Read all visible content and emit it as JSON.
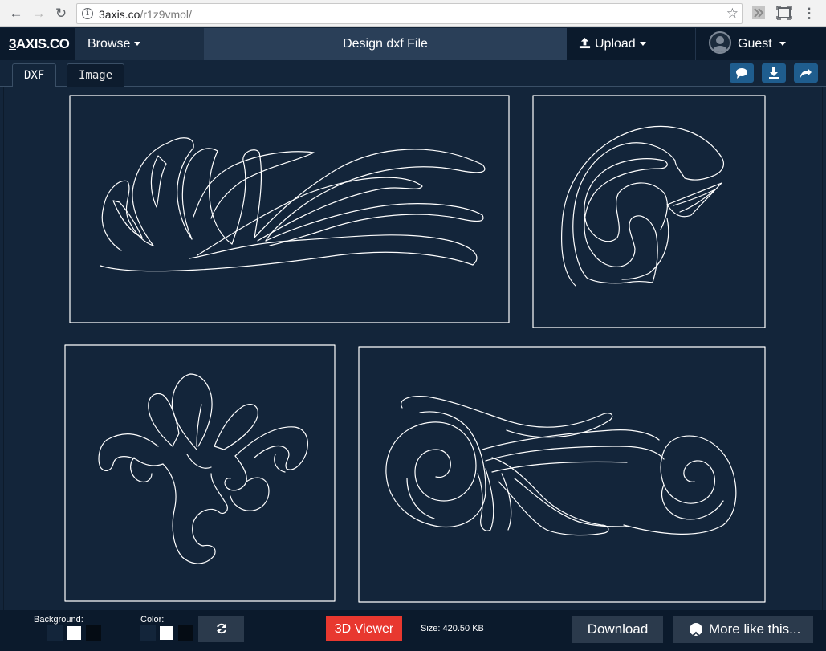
{
  "browser": {
    "url_host": "3axis.co",
    "url_path": "/r1z9vmol/"
  },
  "navbar": {
    "brand_first": "3",
    "brand_rest": "AXIS.CO",
    "browse_label": "Browse",
    "title": "Design dxf File",
    "upload_label": "Upload",
    "user_label": "Guest"
  },
  "tabs": [
    {
      "label": "DXF",
      "active": true
    },
    {
      "label": "Image",
      "active": false
    }
  ],
  "toolbar_icons": [
    "comment-icon",
    "download-icon",
    "share-icon"
  ],
  "footer": {
    "background_label": "Background:",
    "color_label": "Color:",
    "background_swatches": [
      "#13253a",
      "#ffffff",
      "#0b1a2c"
    ],
    "color_swatches": [
      "#13253a",
      "#ffffff",
      "#0b1a2c"
    ],
    "viewer_label": "3D Viewer",
    "size_text": "Size: 420.50 KB",
    "download_label": "Download",
    "more_label": "More like this..."
  },
  "colors": {
    "background": "#13253a",
    "line": "#ffffff",
    "accent_red": "#e8382f",
    "accent_blue": "#1f5d8e"
  }
}
